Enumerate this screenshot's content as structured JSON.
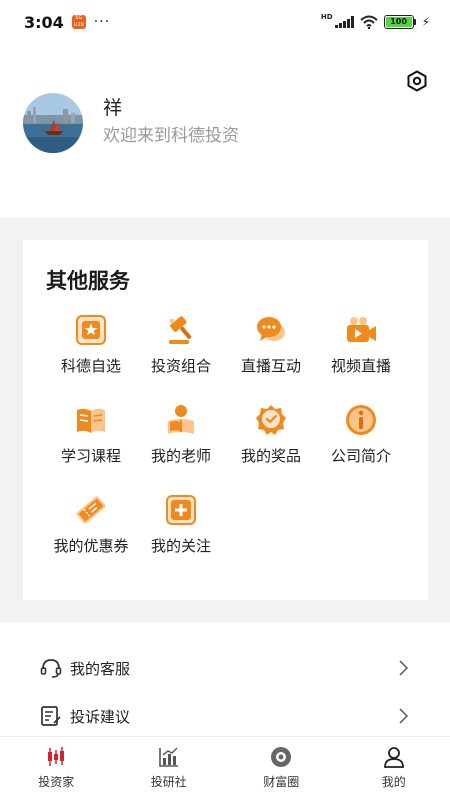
{
  "status": {
    "time": "3:04",
    "app_badge_text": "SG U19",
    "dots": "···",
    "network": "HD",
    "battery": "100"
  },
  "profile": {
    "name": "祥",
    "subtitle": "欢迎来到科德投资"
  },
  "services": {
    "title": "其他服务",
    "accent_color": "#f08a1c",
    "items": [
      {
        "label": "科德自选",
        "icon": "star-icon"
      },
      {
        "label": "投资组合",
        "icon": "gavel-icon"
      },
      {
        "label": "直播互动",
        "icon": "chat-icon"
      },
      {
        "label": "视频直播",
        "icon": "video-camera-icon"
      },
      {
        "label": "学习课程",
        "icon": "book-icon"
      },
      {
        "label": "我的老师",
        "icon": "teacher-icon"
      },
      {
        "label": "我的奖品",
        "icon": "badge-icon"
      },
      {
        "label": "公司简介",
        "icon": "info-icon"
      },
      {
        "label": "我的优惠券",
        "icon": "ticket-icon"
      },
      {
        "label": "我的关注",
        "icon": "plus-icon"
      }
    ]
  },
  "menu": {
    "items": [
      {
        "label": "我的客服",
        "icon": "headset-icon"
      },
      {
        "label": "投诉建议",
        "icon": "feedback-icon"
      }
    ]
  },
  "tabbar": {
    "active_color": "#d8222d",
    "tabs": [
      {
        "label": "投资家",
        "icon": "candlestick-icon",
        "active": false
      },
      {
        "label": "投研社",
        "icon": "bar-chart-icon",
        "active": false
      },
      {
        "label": "财富圈",
        "icon": "disc-icon",
        "active": false
      },
      {
        "label": "我的",
        "icon": "user-icon",
        "active": true
      }
    ]
  }
}
